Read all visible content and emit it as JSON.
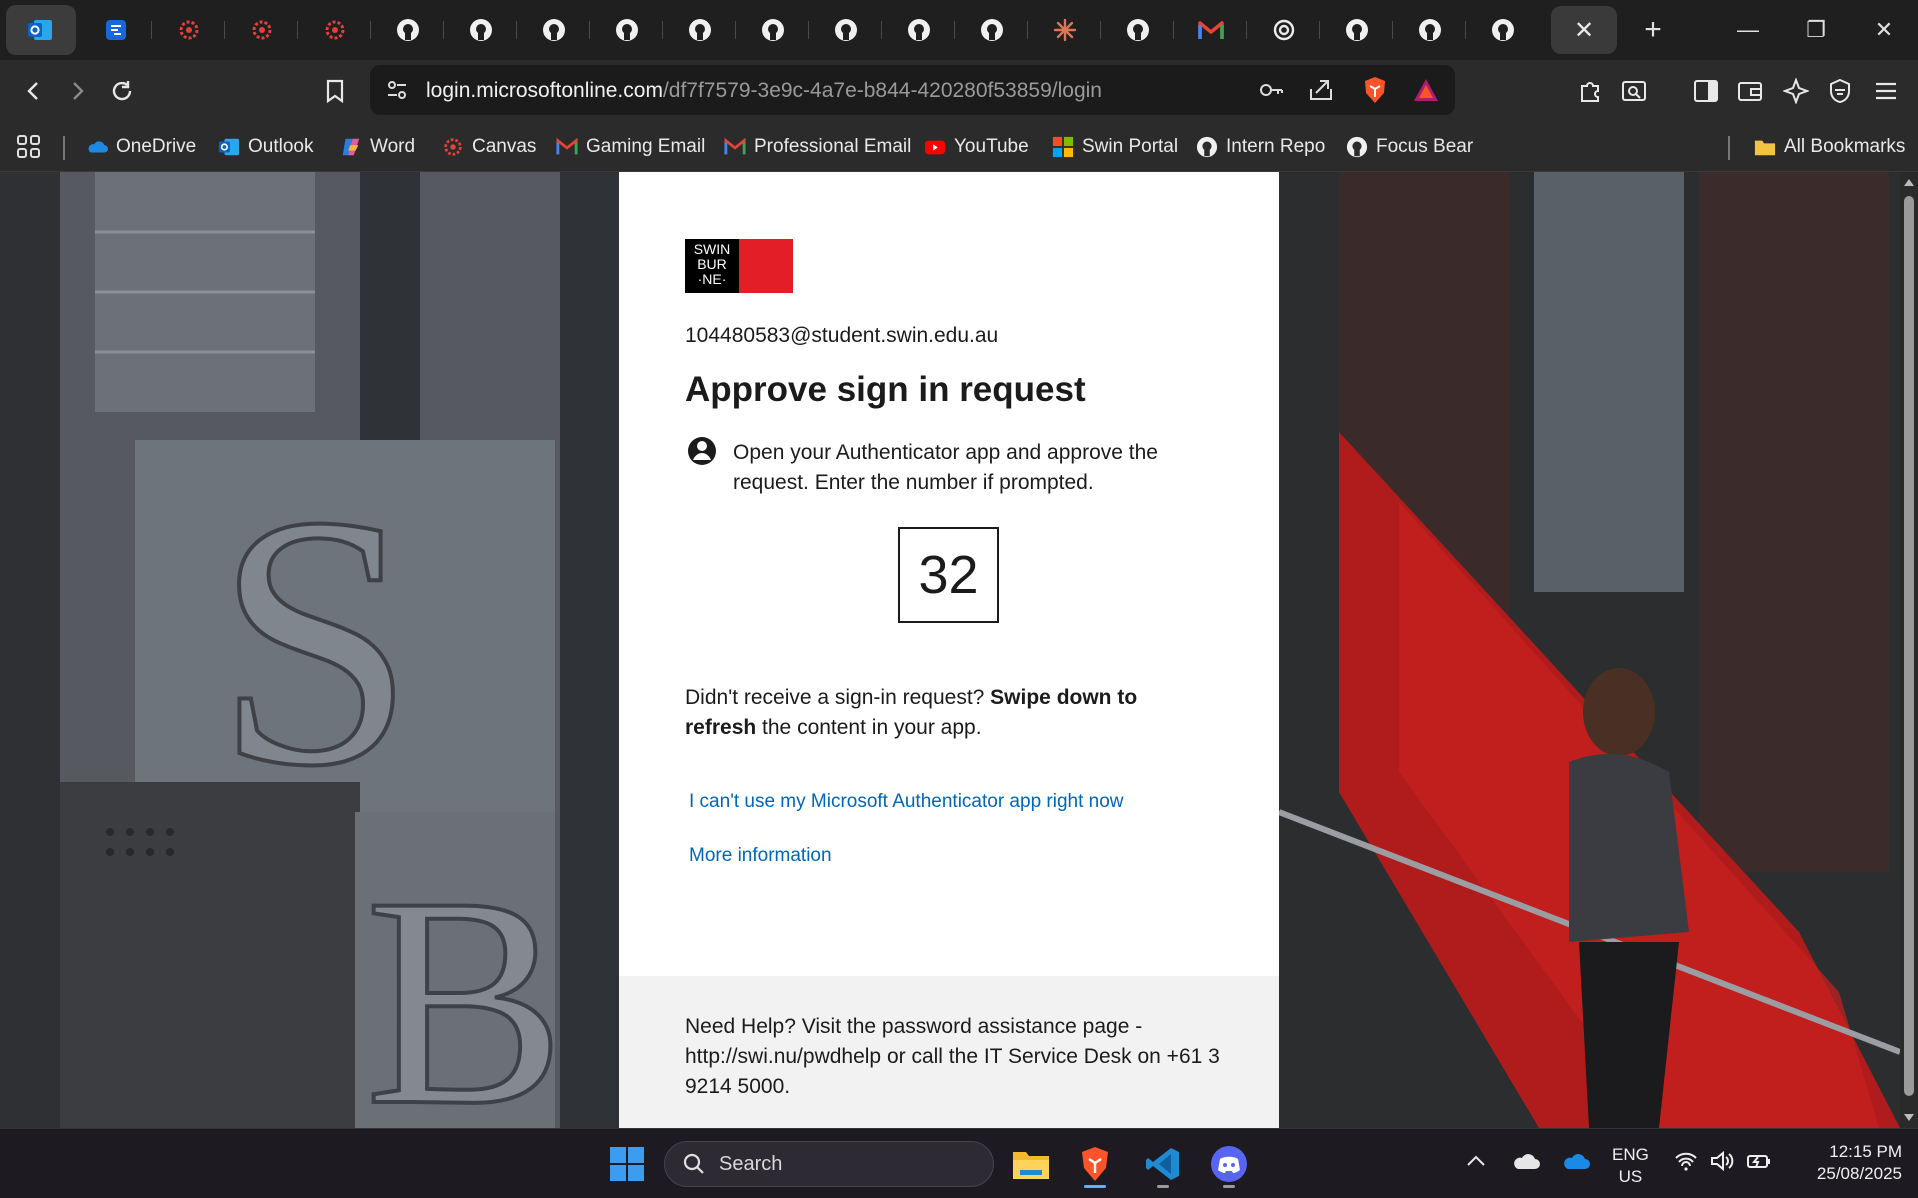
{
  "browser": {
    "url_host": "login.microsoftonline.com",
    "url_path": "/df7f7579-3e9c-4a7e-b844-420280f53859/login",
    "tab_icons": [
      "outlook-icon",
      "jira-icon",
      "canvas-icon",
      "canvas-icon",
      "canvas-icon",
      "github-icon",
      "github-icon",
      "github-icon",
      "github-icon",
      "github-icon",
      "github-icon",
      "github-icon",
      "github-icon",
      "github-icon",
      "claude-icon",
      "github-icon",
      "gmail-icon",
      "chatgpt-icon",
      "github-icon",
      "github-icon",
      "github-icon"
    ],
    "close_tab_glyph": "✕",
    "new_tab_glyph": "+",
    "window_controls": {
      "minimize": "—",
      "restore": "❐",
      "close": "✕"
    }
  },
  "bookmarks": {
    "items": [
      {
        "label": "OneDrive",
        "icon": "onedrive-icon"
      },
      {
        "label": "Outlook",
        "icon": "outlook-icon"
      },
      {
        "label": "Word",
        "icon": "copilot-icon"
      },
      {
        "label": "Canvas",
        "icon": "canvas-icon"
      },
      {
        "label": "Gaming Email",
        "icon": "gmail-icon"
      },
      {
        "label": "Professional Email",
        "icon": "gmail-icon"
      },
      {
        "label": "YouTube",
        "icon": "youtube-icon"
      },
      {
        "label": "Swin Portal",
        "icon": "microsoft-icon"
      },
      {
        "label": "Intern Repo",
        "icon": "github-icon"
      },
      {
        "label": "Focus Bear",
        "icon": "github-icon"
      }
    ],
    "all_bookmarks": "All Bookmarks"
  },
  "login": {
    "logo_text": "SWIN BUR ·NE·",
    "email": "104480583@student.swin.edu.au",
    "title": "Approve sign in request",
    "instruction": "Open your Authenticator app and approve the request. Enter the number if prompted.",
    "number": "32",
    "no_request_prefix": "Didn't receive a sign-in request? ",
    "no_request_bold": "Swipe down to refresh",
    "no_request_suffix": " the content in your app.",
    "link_cant_use": "I can't use my Microsoft Authenticator app right now",
    "link_more_info": "More information",
    "help_text": "Need Help? Visit the password assistance page - http://swi.nu/pwdhelp or call the IT Service Desk on +61 3 9214 5000."
  },
  "taskbar": {
    "search_placeholder": "Search",
    "language_line1": "ENG",
    "language_line2": "US",
    "time": "12:15 PM",
    "date": "25/08/2025"
  },
  "colors": {
    "link": "#0067b8",
    "swinburne_red": "#e41e26",
    "brave_orange": "#fb542b"
  }
}
